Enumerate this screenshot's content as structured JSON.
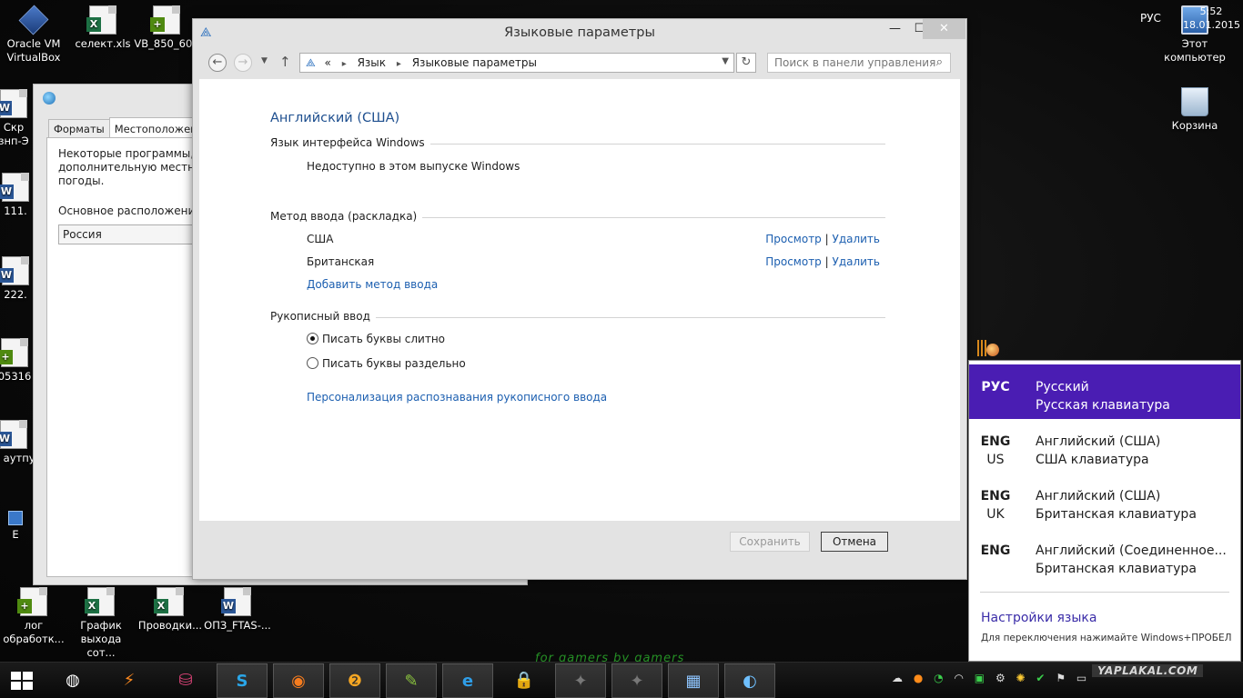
{
  "desktop": {
    "icons_left": [
      {
        "label": "Oracle VM VirtualBox",
        "type": "virtualbox-icon"
      },
      {
        "label": "селект.xls",
        "type": "excel-file-icon"
      },
      {
        "label": "VB_850_600",
        "type": "notepad-file-icon"
      },
      {
        "label": "Скр знп-Э",
        "type": "word-file-icon"
      },
      {
        "label": "111.",
        "type": "word-file-icon"
      },
      {
        "label": "222.",
        "type": "word-file-icon"
      },
      {
        "label": "05316",
        "type": "notepad-file-icon"
      },
      {
        "label": "И аутпу",
        "type": "word-file-icon"
      },
      {
        "label": "Е",
        "type": "shortcut-icon"
      }
    ],
    "icons_bottom": [
      {
        "label": "лог обработк...",
        "type": "notepad-file-icon"
      },
      {
        "label": "График выхода сот...",
        "type": "excel-file-icon"
      },
      {
        "label": "Проводки...",
        "type": "excel-file-icon"
      },
      {
        "label": "ОПЗ_FTAS-...",
        "type": "word-file-icon"
      }
    ],
    "icons_right": [
      {
        "label": "Этот компьютер",
        "type": "computer-icon"
      },
      {
        "label": "Корзина",
        "type": "recycle-bin-icon"
      }
    ],
    "wallpaper_text": "for gamers by gamers"
  },
  "background_window": {
    "tabs": [
      "Форматы",
      "Местоположение"
    ],
    "active_tab": "Местоположение",
    "description": "Некоторые программы, в т дополнительную местну погоды.",
    "location_label": "Основное расположение:",
    "location_value": "Россия"
  },
  "main_window": {
    "title": "Языковые параметры",
    "controls": {
      "minimize": "—",
      "maximize": "☐",
      "close": "✕"
    },
    "address": {
      "prefix": "«",
      "crumbs": [
        "Язык",
        "Языковые параметры"
      ]
    },
    "search_placeholder": "Поиск в панели управления",
    "language_title": "Английский (США)",
    "sections": {
      "ui_language": {
        "heading": "Язык интерфейса Windows",
        "text": "Недоступно в этом выпуске Windows"
      },
      "input_method": {
        "heading": "Метод ввода (раскладка)",
        "items": [
          {
            "name": "США",
            "preview": "Просмотр",
            "remove": "Удалить"
          },
          {
            "name": "Британская",
            "preview": "Просмотр",
            "remove": "Удалить"
          }
        ],
        "add_link": "Добавить метод ввода"
      },
      "handwriting": {
        "heading": "Рукописный ввод",
        "options": [
          {
            "label": "Писать буквы слитно",
            "selected": true
          },
          {
            "label": "Писать буквы раздельно",
            "selected": false
          }
        ],
        "personalize_link": "Персонализация распознавания рукописного ввода"
      }
    },
    "buttons": {
      "save": "Сохранить",
      "cancel": "Отмена"
    }
  },
  "language_flyout": {
    "items": [
      {
        "code": "РУС",
        "sub": "",
        "line1": "Русский",
        "line2": "Русская клавиатура",
        "active": true
      },
      {
        "code": "ENG",
        "sub": "US",
        "line1": "Английский (США)",
        "line2": "США клавиатура",
        "active": false
      },
      {
        "code": "ENG",
        "sub": "UK",
        "line1": "Английский (США)",
        "line2": "Британская клавиатура",
        "active": false
      },
      {
        "code": "ENG",
        "sub": "",
        "line1": "Английский (Соединенное...",
        "line2": "Британская клавиатура",
        "active": false
      }
    ],
    "settings_link": "Настройки языка",
    "hint": "Для переключения нажимайте Windows+ПРОБЕЛ",
    "active_color": "#4a1db3"
  },
  "taskbar": {
    "apps": [
      "steam-icon",
      "winamp-icon",
      "database-icon",
      "skype-icon",
      "firefox-icon",
      "install-icon",
      "notepad-plus-icon",
      "internet-explorer-icon",
      "vpn-icon",
      "game-icon",
      "game-icon",
      "control-panel-icon",
      "globe-icon"
    ],
    "tray_lang": "РУС",
    "time": "5:52",
    "date": "18.01.2015",
    "watermark": "YAPLAKAL.COM"
  }
}
